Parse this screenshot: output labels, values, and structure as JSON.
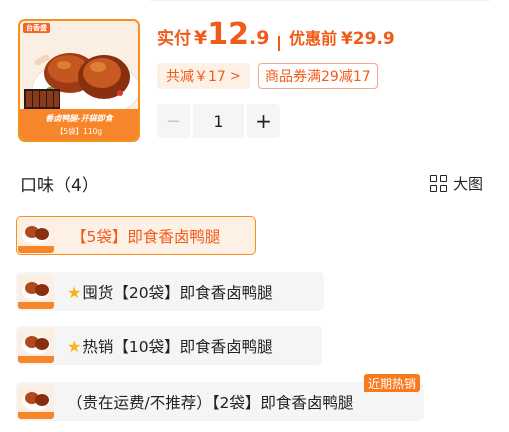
{
  "product": {
    "thumb_logo": "台香盛",
    "thumb_caption_line1": "香卤鸭腿-开袋即食",
    "thumb_caption_line2": "【5袋】110g",
    "price_label": "实付",
    "currency": "¥",
    "price_integer": "12",
    "price_decimal": ".9",
    "original_label": "优惠前",
    "original_price": "¥29.9"
  },
  "discounts": {
    "total_reduction": "共减￥17",
    "total_chevron": ">",
    "coupon": "商品券满29减17"
  },
  "quantity": {
    "minus": "−",
    "value": "1",
    "plus": "+"
  },
  "flavor_section": {
    "title": "口味（4）",
    "view_label": "大图"
  },
  "options": [
    {
      "label": "【5袋】即食香卤鸭腿",
      "selected": true,
      "star": false,
      "badge": ""
    },
    {
      "label": "囤货【20袋】即食香卤鸭腿",
      "selected": false,
      "star": true,
      "badge": ""
    },
    {
      "label": "热销【10袋】即食香卤鸭腿",
      "selected": false,
      "star": true,
      "badge": ""
    },
    {
      "label": "（贵在运费/不推荐）【2袋】即食香卤鸭腿",
      "selected": false,
      "star": false,
      "badge": "近期热销"
    }
  ],
  "icons": {
    "star": "star-icon",
    "view": "grid-view-icon"
  },
  "colors": {
    "accent": "#f25a1a",
    "border_accent": "#f6901f",
    "tag_bg": "#fdf1e6",
    "star": "#f7b318"
  }
}
